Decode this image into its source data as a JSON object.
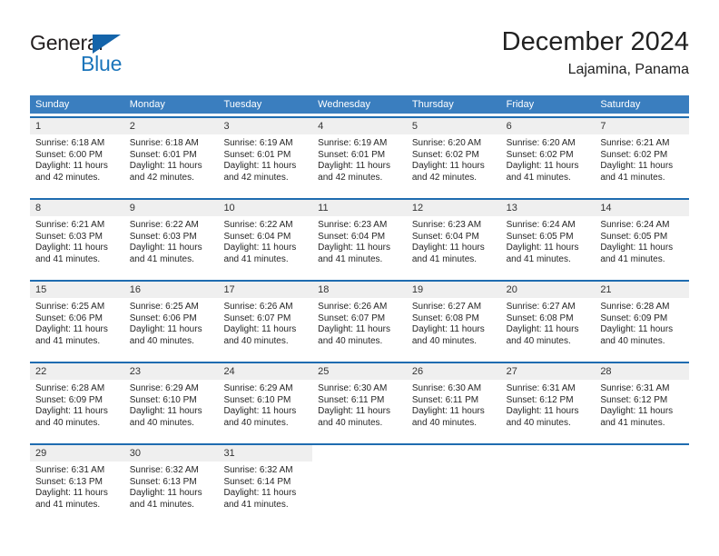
{
  "brand": {
    "name_part1": "General",
    "name_part2": "Blue",
    "logo_icon": "blue-triangle-icon",
    "color_dark": "#231f20",
    "color_blue": "#1b75bb"
  },
  "header": {
    "title": "December 2024",
    "subtitle": "Lajamina, Panama"
  },
  "theme": {
    "header_row_bg": "#3a7ebf",
    "week_divider": "#1f6cb0",
    "day_number_bg": "#efefef",
    "text": "#262626"
  },
  "weekdays": [
    "Sunday",
    "Monday",
    "Tuesday",
    "Wednesday",
    "Thursday",
    "Friday",
    "Saturday"
  ],
  "weeks": [
    {
      "days": [
        {
          "number": "1",
          "sunrise": "Sunrise: 6:18 AM",
          "sunset": "Sunset: 6:00 PM",
          "daylight_1": "Daylight: 11 hours",
          "daylight_2": "and 42 minutes."
        },
        {
          "number": "2",
          "sunrise": "Sunrise: 6:18 AM",
          "sunset": "Sunset: 6:01 PM",
          "daylight_1": "Daylight: 11 hours",
          "daylight_2": "and 42 minutes."
        },
        {
          "number": "3",
          "sunrise": "Sunrise: 6:19 AM",
          "sunset": "Sunset: 6:01 PM",
          "daylight_1": "Daylight: 11 hours",
          "daylight_2": "and 42 minutes."
        },
        {
          "number": "4",
          "sunrise": "Sunrise: 6:19 AM",
          "sunset": "Sunset: 6:01 PM",
          "daylight_1": "Daylight: 11 hours",
          "daylight_2": "and 42 minutes."
        },
        {
          "number": "5",
          "sunrise": "Sunrise: 6:20 AM",
          "sunset": "Sunset: 6:02 PM",
          "daylight_1": "Daylight: 11 hours",
          "daylight_2": "and 42 minutes."
        },
        {
          "number": "6",
          "sunrise": "Sunrise: 6:20 AM",
          "sunset": "Sunset: 6:02 PM",
          "daylight_1": "Daylight: 11 hours",
          "daylight_2": "and 41 minutes."
        },
        {
          "number": "7",
          "sunrise": "Sunrise: 6:21 AM",
          "sunset": "Sunset: 6:02 PM",
          "daylight_1": "Daylight: 11 hours",
          "daylight_2": "and 41 minutes."
        }
      ]
    },
    {
      "days": [
        {
          "number": "8",
          "sunrise": "Sunrise: 6:21 AM",
          "sunset": "Sunset: 6:03 PM",
          "daylight_1": "Daylight: 11 hours",
          "daylight_2": "and 41 minutes."
        },
        {
          "number": "9",
          "sunrise": "Sunrise: 6:22 AM",
          "sunset": "Sunset: 6:03 PM",
          "daylight_1": "Daylight: 11 hours",
          "daylight_2": "and 41 minutes."
        },
        {
          "number": "10",
          "sunrise": "Sunrise: 6:22 AM",
          "sunset": "Sunset: 6:04 PM",
          "daylight_1": "Daylight: 11 hours",
          "daylight_2": "and 41 minutes."
        },
        {
          "number": "11",
          "sunrise": "Sunrise: 6:23 AM",
          "sunset": "Sunset: 6:04 PM",
          "daylight_1": "Daylight: 11 hours",
          "daylight_2": "and 41 minutes."
        },
        {
          "number": "12",
          "sunrise": "Sunrise: 6:23 AM",
          "sunset": "Sunset: 6:04 PM",
          "daylight_1": "Daylight: 11 hours",
          "daylight_2": "and 41 minutes."
        },
        {
          "number": "13",
          "sunrise": "Sunrise: 6:24 AM",
          "sunset": "Sunset: 6:05 PM",
          "daylight_1": "Daylight: 11 hours",
          "daylight_2": "and 41 minutes."
        },
        {
          "number": "14",
          "sunrise": "Sunrise: 6:24 AM",
          "sunset": "Sunset: 6:05 PM",
          "daylight_1": "Daylight: 11 hours",
          "daylight_2": "and 41 minutes."
        }
      ]
    },
    {
      "days": [
        {
          "number": "15",
          "sunrise": "Sunrise: 6:25 AM",
          "sunset": "Sunset: 6:06 PM",
          "daylight_1": "Daylight: 11 hours",
          "daylight_2": "and 41 minutes."
        },
        {
          "number": "16",
          "sunrise": "Sunrise: 6:25 AM",
          "sunset": "Sunset: 6:06 PM",
          "daylight_1": "Daylight: 11 hours",
          "daylight_2": "and 40 minutes."
        },
        {
          "number": "17",
          "sunrise": "Sunrise: 6:26 AM",
          "sunset": "Sunset: 6:07 PM",
          "daylight_1": "Daylight: 11 hours",
          "daylight_2": "and 40 minutes."
        },
        {
          "number": "18",
          "sunrise": "Sunrise: 6:26 AM",
          "sunset": "Sunset: 6:07 PM",
          "daylight_1": "Daylight: 11 hours",
          "daylight_2": "and 40 minutes."
        },
        {
          "number": "19",
          "sunrise": "Sunrise: 6:27 AM",
          "sunset": "Sunset: 6:08 PM",
          "daylight_1": "Daylight: 11 hours",
          "daylight_2": "and 40 minutes."
        },
        {
          "number": "20",
          "sunrise": "Sunrise: 6:27 AM",
          "sunset": "Sunset: 6:08 PM",
          "daylight_1": "Daylight: 11 hours",
          "daylight_2": "and 40 minutes."
        },
        {
          "number": "21",
          "sunrise": "Sunrise: 6:28 AM",
          "sunset": "Sunset: 6:09 PM",
          "daylight_1": "Daylight: 11 hours",
          "daylight_2": "and 40 minutes."
        }
      ]
    },
    {
      "days": [
        {
          "number": "22",
          "sunrise": "Sunrise: 6:28 AM",
          "sunset": "Sunset: 6:09 PM",
          "daylight_1": "Daylight: 11 hours",
          "daylight_2": "and 40 minutes."
        },
        {
          "number": "23",
          "sunrise": "Sunrise: 6:29 AM",
          "sunset": "Sunset: 6:10 PM",
          "daylight_1": "Daylight: 11 hours",
          "daylight_2": "and 40 minutes."
        },
        {
          "number": "24",
          "sunrise": "Sunrise: 6:29 AM",
          "sunset": "Sunset: 6:10 PM",
          "daylight_1": "Daylight: 11 hours",
          "daylight_2": "and 40 minutes."
        },
        {
          "number": "25",
          "sunrise": "Sunrise: 6:30 AM",
          "sunset": "Sunset: 6:11 PM",
          "daylight_1": "Daylight: 11 hours",
          "daylight_2": "and 40 minutes."
        },
        {
          "number": "26",
          "sunrise": "Sunrise: 6:30 AM",
          "sunset": "Sunset: 6:11 PM",
          "daylight_1": "Daylight: 11 hours",
          "daylight_2": "and 40 minutes."
        },
        {
          "number": "27",
          "sunrise": "Sunrise: 6:31 AM",
          "sunset": "Sunset: 6:12 PM",
          "daylight_1": "Daylight: 11 hours",
          "daylight_2": "and 40 minutes."
        },
        {
          "number": "28",
          "sunrise": "Sunrise: 6:31 AM",
          "sunset": "Sunset: 6:12 PM",
          "daylight_1": "Daylight: 11 hours",
          "daylight_2": "and 41 minutes."
        }
      ]
    },
    {
      "days": [
        {
          "number": "29",
          "sunrise": "Sunrise: 6:31 AM",
          "sunset": "Sunset: 6:13 PM",
          "daylight_1": "Daylight: 11 hours",
          "daylight_2": "and 41 minutes."
        },
        {
          "number": "30",
          "sunrise": "Sunrise: 6:32 AM",
          "sunset": "Sunset: 6:13 PM",
          "daylight_1": "Daylight: 11 hours",
          "daylight_2": "and 41 minutes."
        },
        {
          "number": "31",
          "sunrise": "Sunrise: 6:32 AM",
          "sunset": "Sunset: 6:14 PM",
          "daylight_1": "Daylight: 11 hours",
          "daylight_2": "and 41 minutes."
        },
        {
          "number": "",
          "sunrise": "",
          "sunset": "",
          "daylight_1": "",
          "daylight_2": ""
        },
        {
          "number": "",
          "sunrise": "",
          "sunset": "",
          "daylight_1": "",
          "daylight_2": ""
        },
        {
          "number": "",
          "sunrise": "",
          "sunset": "",
          "daylight_1": "",
          "daylight_2": ""
        },
        {
          "number": "",
          "sunrise": "",
          "sunset": "",
          "daylight_1": "",
          "daylight_2": ""
        }
      ]
    }
  ]
}
